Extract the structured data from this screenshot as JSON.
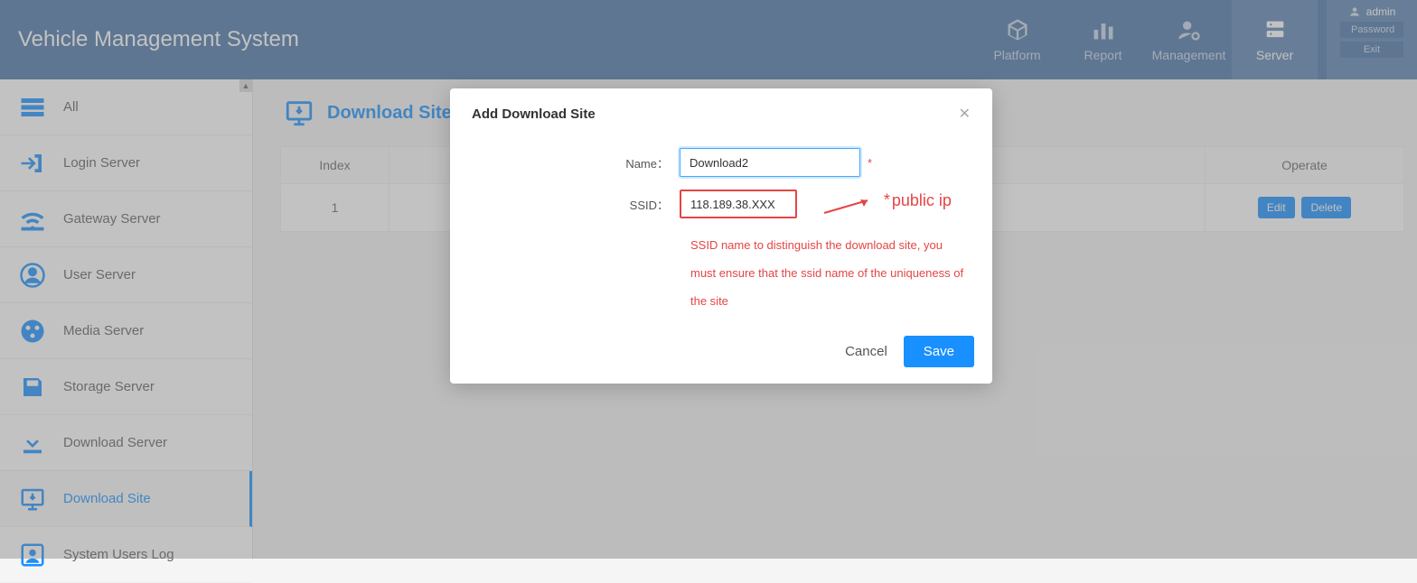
{
  "header": {
    "title": "Vehicle Management System",
    "nav": [
      {
        "label": "Platform"
      },
      {
        "label": "Report"
      },
      {
        "label": "Management"
      },
      {
        "label": "Server"
      }
    ],
    "user": {
      "name": "admin",
      "password_btn": "Password",
      "exit_btn": "Exit"
    }
  },
  "sidebar": {
    "items": [
      {
        "label": "All"
      },
      {
        "label": "Login Server"
      },
      {
        "label": "Gateway Server"
      },
      {
        "label": "User Server"
      },
      {
        "label": "Media Server"
      },
      {
        "label": "Storage Server"
      },
      {
        "label": "Download Server"
      },
      {
        "label": "Download Site"
      },
      {
        "label": "System Users Log"
      }
    ]
  },
  "page": {
    "title": "Download Site",
    "columns": {
      "index": "Index",
      "operate": "Operate"
    },
    "row": {
      "index": "1",
      "edit": "Edit",
      "delete": "Delete"
    }
  },
  "modal": {
    "title": "Add Download Site",
    "name_label": "Name：",
    "name_value": "Download2",
    "ssid_label": "SSID：",
    "ssid_value": "118.189.38.XXX",
    "annotation": "public ip",
    "help": "SSID name to distinguish the download site, you must ensure that the ssid name of the uniqueness of the site",
    "cancel": "Cancel",
    "save": "Save"
  }
}
